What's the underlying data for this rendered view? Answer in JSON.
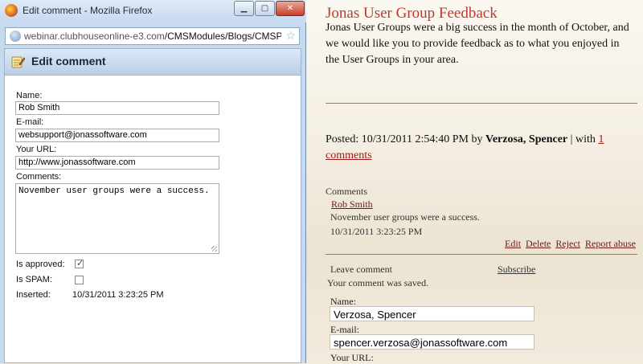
{
  "popup": {
    "window_title": "Edit comment - Mozilla Firefox",
    "window_buttons": {
      "minimize": "▁",
      "maximize": "▢",
      "close": "✕"
    },
    "address": {
      "domain": "webinar.clubhouseonline-e3.com",
      "path": "/CMSModules/Blogs/CMSPages/C"
    },
    "dialog_title": "Edit comment",
    "form": {
      "name_label": "Name:",
      "name_value": "Rob Smith",
      "email_label": "E-mail:",
      "email_value": "websupport@jonassoftware.com",
      "url_label": "Your URL:",
      "url_value": "http://www.jonassoftware.com",
      "comments_label": "Comments:",
      "comments_value": "November user groups were a success.",
      "approved_label": "Is approved:",
      "approved_checked": true,
      "spam_label": "Is SPAM:",
      "spam_checked": false,
      "inserted_label": "Inserted:",
      "inserted_value": "10/31/2011 3:23:25 PM"
    }
  },
  "blog": {
    "title": "Jonas User Group Feedback",
    "body": "Jonas User Groups were a big success in the month of October, and we would like you to provide feedback as to what you enjoyed in the User Groups in your area.",
    "posted_prefix": "Posted: 10/31/2011 2:54:40 PM by",
    "posted_author": "Verzosa, Spencer",
    "posted_sep": "| with",
    "comments_link": "1 comments",
    "comments_heading": "Comments",
    "comment": {
      "author": "Rob Smith",
      "text": "November user groups were a success.",
      "date": "10/31/2011 3:23:25 PM",
      "actions": [
        "Edit",
        "Delete",
        "Reject",
        "Report abuse"
      ]
    },
    "leave_comment": "Leave comment",
    "subscribe": "Subscribe",
    "saved_message": "Your comment was saved.",
    "form": {
      "name_label": "Name:",
      "name_value": "Verzosa, Spencer",
      "email_label": "E-mail:",
      "email_value": "spencer.verzosa@jonassoftware.com",
      "url_label": "Your URL:"
    }
  }
}
